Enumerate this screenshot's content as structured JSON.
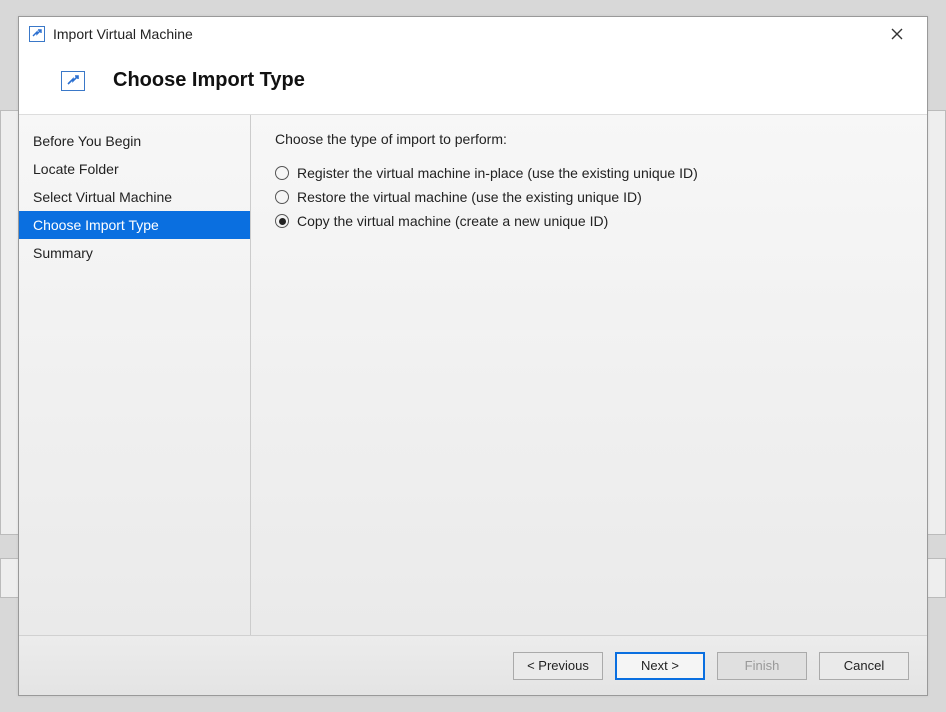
{
  "window": {
    "title": "Import Virtual Machine"
  },
  "header": {
    "title": "Choose Import Type"
  },
  "sidebar": {
    "steps": [
      {
        "label": "Before You Begin",
        "active": false
      },
      {
        "label": "Locate Folder",
        "active": false
      },
      {
        "label": "Select Virtual Machine",
        "active": false
      },
      {
        "label": "Choose Import Type",
        "active": true
      },
      {
        "label": "Summary",
        "active": false
      }
    ]
  },
  "content": {
    "prompt": "Choose the type of import to perform:",
    "options": [
      {
        "label": "Register the virtual machine in-place (use the existing unique ID)",
        "selected": false
      },
      {
        "label": "Restore the virtual machine (use the existing unique ID)",
        "selected": false
      },
      {
        "label": "Copy the virtual machine (create a new unique ID)",
        "selected": true
      }
    ]
  },
  "footer": {
    "previous": "< Previous",
    "next": "Next >",
    "finish": "Finish",
    "cancel": "Cancel",
    "finish_disabled": true
  }
}
